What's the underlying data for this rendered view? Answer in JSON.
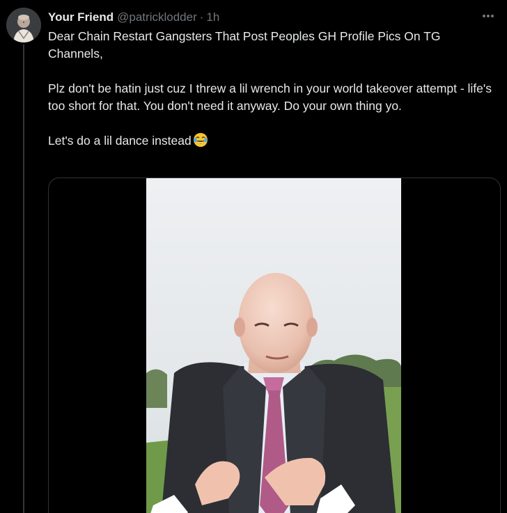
{
  "tweet": {
    "author": {
      "display_name": "Your Friend",
      "handle": "@patricklodder",
      "avatar_icon": "avatar-monk-icon"
    },
    "separator": "·",
    "timestamp": "1h",
    "more_icon": "ellipsis-icon",
    "paragraphs": [
      "Dear Chain Restart Gangsters That Post Peoples GH Profile Pics On TG Channels,",
      "Plz don't be hatin just cuz I threw a lil wrench in your world takeover attempt - life's too short for that. You don't need it anyway. Do your own thing yo.",
      "Let's do a lil dance instead"
    ],
    "emoji_icon": "face-with-tears-of-joy-icon",
    "media": {
      "type": "video",
      "thumbnail_icon": "dancing-man-video-thumbnail"
    }
  },
  "colors": {
    "background": "#000000",
    "text_primary": "#e7e9ea",
    "text_secondary": "#71767b",
    "border": "#2f3336"
  }
}
